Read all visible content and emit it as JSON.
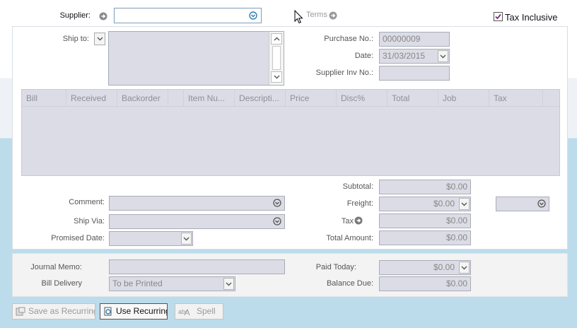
{
  "header": {
    "supplier_label": "Supplier:",
    "terms_label": "Terms",
    "tax_inclusive_label": "Tax Inclusive",
    "tax_inclusive_checked": true
  },
  "address": {
    "ship_to_label": "Ship to:"
  },
  "order": {
    "purchase_no_label": "Purchase No.:",
    "purchase_no": "00000009",
    "date_label": "Date:",
    "date": "31/03/2015",
    "supplier_inv_label": "Supplier Inv No.:"
  },
  "grid": {
    "columns": [
      "Bill",
      "Received",
      "Backorder",
      "Item Nu...",
      "Descripti...",
      "Price",
      "Disc%",
      "Total",
      "Job",
      "Tax"
    ]
  },
  "details": {
    "comment_label": "Comment:",
    "ship_via_label": "Ship Via:",
    "promised_date_label": "Promised Date:"
  },
  "totals": {
    "subtotal_label": "Subtotal:",
    "subtotal": "$0.00",
    "freight_label": "Freight:",
    "freight": "$0.00",
    "tax_label": "Tax",
    "tax": "$0.00",
    "total_amount_label": "Total Amount:",
    "total_amount": "$0.00"
  },
  "footer": {
    "journal_memo_label": "Journal Memo:",
    "bill_delivery_label": "Bill Delivery",
    "bill_delivery_value": "To be Printed",
    "paid_today_label": "Paid Today:",
    "paid_today": "$0.00",
    "balance_due_label": "Balance Due:",
    "balance_due": "$0.00"
  },
  "actions": {
    "save_recurring": "Save as Recurring",
    "use_recurring": "Use Recurring",
    "spell": "Spell"
  },
  "colors": {
    "field_bg": "#dcdce6",
    "lower_band": "#bcdcec",
    "accent_icon": "#2a7fb8"
  }
}
